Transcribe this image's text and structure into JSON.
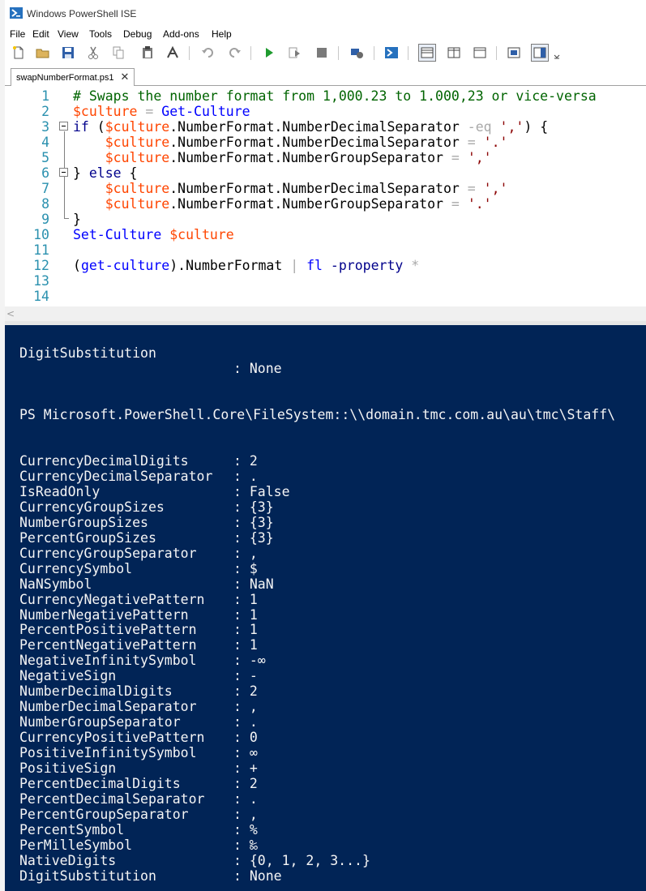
{
  "window": {
    "title": "Windows PowerShell ISE"
  },
  "menu": [
    "File",
    "Edit",
    "View",
    "Tools",
    "Debug",
    "Add-ons",
    "Help"
  ],
  "tab": {
    "label": "swapNumberFormat.ps1",
    "close": "✕"
  },
  "editor": {
    "line_numbers": [
      "1",
      "2",
      "3",
      "4",
      "5",
      "6",
      "7",
      "8",
      "9",
      "10",
      "11",
      "12",
      "13",
      "14"
    ],
    "lines": [
      [
        {
          "t": "# Swaps the number format from 1,000.23 to 1.000,23 or vice-versa",
          "c": "c-comment"
        }
      ],
      [
        {
          "t": "$culture",
          "c": "c-var"
        },
        {
          "t": " = ",
          "c": "c-op"
        },
        {
          "t": "Get-Culture",
          "c": "c-cmd"
        }
      ],
      [
        {
          "t": "if",
          "c": "c-kw"
        },
        {
          "t": " (",
          "c": "c-punc"
        },
        {
          "t": "$culture",
          "c": "c-var"
        },
        {
          "t": ".NumberFormat.NumberDecimalSeparator",
          "c": "c-prop"
        },
        {
          "t": " -eq ",
          "c": "c-op"
        },
        {
          "t": "','",
          "c": "c-str"
        },
        {
          "t": ") {",
          "c": "c-punc"
        }
      ],
      [
        {
          "t": "    ",
          "c": "c-punc"
        },
        {
          "t": "$culture",
          "c": "c-var"
        },
        {
          "t": ".NumberFormat.NumberDecimalSeparator",
          "c": "c-prop"
        },
        {
          "t": " = ",
          "c": "c-op"
        },
        {
          "t": "'.'",
          "c": "c-str"
        }
      ],
      [
        {
          "t": "    ",
          "c": "c-punc"
        },
        {
          "t": "$culture",
          "c": "c-var"
        },
        {
          "t": ".NumberFormat.NumberGroupSeparator",
          "c": "c-prop"
        },
        {
          "t": " = ",
          "c": "c-op"
        },
        {
          "t": "','",
          "c": "c-str"
        }
      ],
      [
        {
          "t": "} ",
          "c": "c-punc"
        },
        {
          "t": "else",
          "c": "c-kw"
        },
        {
          "t": " {",
          "c": "c-punc"
        }
      ],
      [
        {
          "t": "    ",
          "c": "c-punc"
        },
        {
          "t": "$culture",
          "c": "c-var"
        },
        {
          "t": ".NumberFormat.NumberDecimalSeparator",
          "c": "c-prop"
        },
        {
          "t": " = ",
          "c": "c-op"
        },
        {
          "t": "','",
          "c": "c-str"
        }
      ],
      [
        {
          "t": "    ",
          "c": "c-punc"
        },
        {
          "t": "$culture",
          "c": "c-var"
        },
        {
          "t": ".NumberFormat.NumberGroupSeparator",
          "c": "c-prop"
        },
        {
          "t": " = ",
          "c": "c-op"
        },
        {
          "t": "'.'",
          "c": "c-str"
        }
      ],
      [
        {
          "t": "}",
          "c": "c-punc"
        }
      ],
      [
        {
          "t": "Set-Culture",
          "c": "c-cmd"
        },
        {
          "t": " ",
          "c": "c-punc"
        },
        {
          "t": "$culture",
          "c": "c-var"
        }
      ],
      [],
      [
        {
          "t": "(",
          "c": "c-punc"
        },
        {
          "t": "get-culture",
          "c": "c-cmd"
        },
        {
          "t": ").NumberFormat",
          "c": "c-prop"
        },
        {
          "t": " | ",
          "c": "c-op"
        },
        {
          "t": "fl",
          "c": "c-cmd"
        },
        {
          "t": " -property",
          "c": "c-kw"
        },
        {
          "t": " *",
          "c": "c-op"
        }
      ],
      [],
      []
    ]
  },
  "console": {
    "top_entry": {
      "key": "DigitSubstitution",
      "sep": ":",
      "value": "None"
    },
    "prompt": "PS Microsoft.PowerShell.Core\\FileSystem::\\\\domain.tmc.com.au\\au\\tmc\\Staff\\",
    "entries": [
      {
        "key": "CurrencyDecimalDigits",
        "value": "2"
      },
      {
        "key": "CurrencyDecimalSeparator",
        "value": "."
      },
      {
        "key": "IsReadOnly",
        "value": "False"
      },
      {
        "key": "CurrencyGroupSizes",
        "value": "{3}"
      },
      {
        "key": "NumberGroupSizes",
        "value": "{3}"
      },
      {
        "key": "PercentGroupSizes",
        "value": "{3}"
      },
      {
        "key": "CurrencyGroupSeparator",
        "value": ","
      },
      {
        "key": "CurrencySymbol",
        "value": "$"
      },
      {
        "key": "NaNSymbol",
        "value": "NaN"
      },
      {
        "key": "CurrencyNegativePattern",
        "value": "1"
      },
      {
        "key": "NumberNegativePattern",
        "value": "1"
      },
      {
        "key": "PercentPositivePattern",
        "value": "1"
      },
      {
        "key": "PercentNegativePattern",
        "value": "1"
      },
      {
        "key": "NegativeInfinitySymbol",
        "value": "-∞"
      },
      {
        "key": "NegativeSign",
        "value": "-"
      },
      {
        "key": "NumberDecimalDigits",
        "value": "2"
      },
      {
        "key": "NumberDecimalSeparator",
        "value": ","
      },
      {
        "key": "NumberGroupSeparator",
        "value": "."
      },
      {
        "key": "CurrencyPositivePattern",
        "value": "0"
      },
      {
        "key": "PositiveInfinitySymbol",
        "value": "∞"
      },
      {
        "key": "PositiveSign",
        "value": "+"
      },
      {
        "key": "PercentDecimalDigits",
        "value": "2"
      },
      {
        "key": "PercentDecimalSeparator",
        "value": "."
      },
      {
        "key": "PercentGroupSeparator",
        "value": ","
      },
      {
        "key": "PercentSymbol",
        "value": "%"
      },
      {
        "key": "PerMilleSymbol",
        "value": "‰"
      },
      {
        "key": "NativeDigits",
        "value": "{0, 1, 2, 3...}"
      },
      {
        "key": "DigitSubstitution",
        "value": "None"
      }
    ],
    "separator": ":"
  },
  "colors": {
    "console_bg": "#012456",
    "comment": "#006400",
    "variable": "#ff4500",
    "command": "#0000ff",
    "string": "#8b0000",
    "keyword": "#00008b",
    "line_number": "#2b91af"
  },
  "toolbar_icons": [
    "new-file-icon",
    "open-folder-icon",
    "save-icon",
    "cut-icon",
    "copy-icon",
    "paste-icon",
    "clear-icon",
    "undo-icon",
    "redo-icon",
    "run-script-icon",
    "run-selection-icon",
    "stop-icon",
    "remote-powershell-icon",
    "powershell-console-icon",
    "show-script-pane-top-icon",
    "show-script-pane-right-icon",
    "show-script-pane-maximized-icon",
    "show-command-window-icon",
    "show-command-addon-icon",
    "toolbar-overflow-icon"
  ]
}
